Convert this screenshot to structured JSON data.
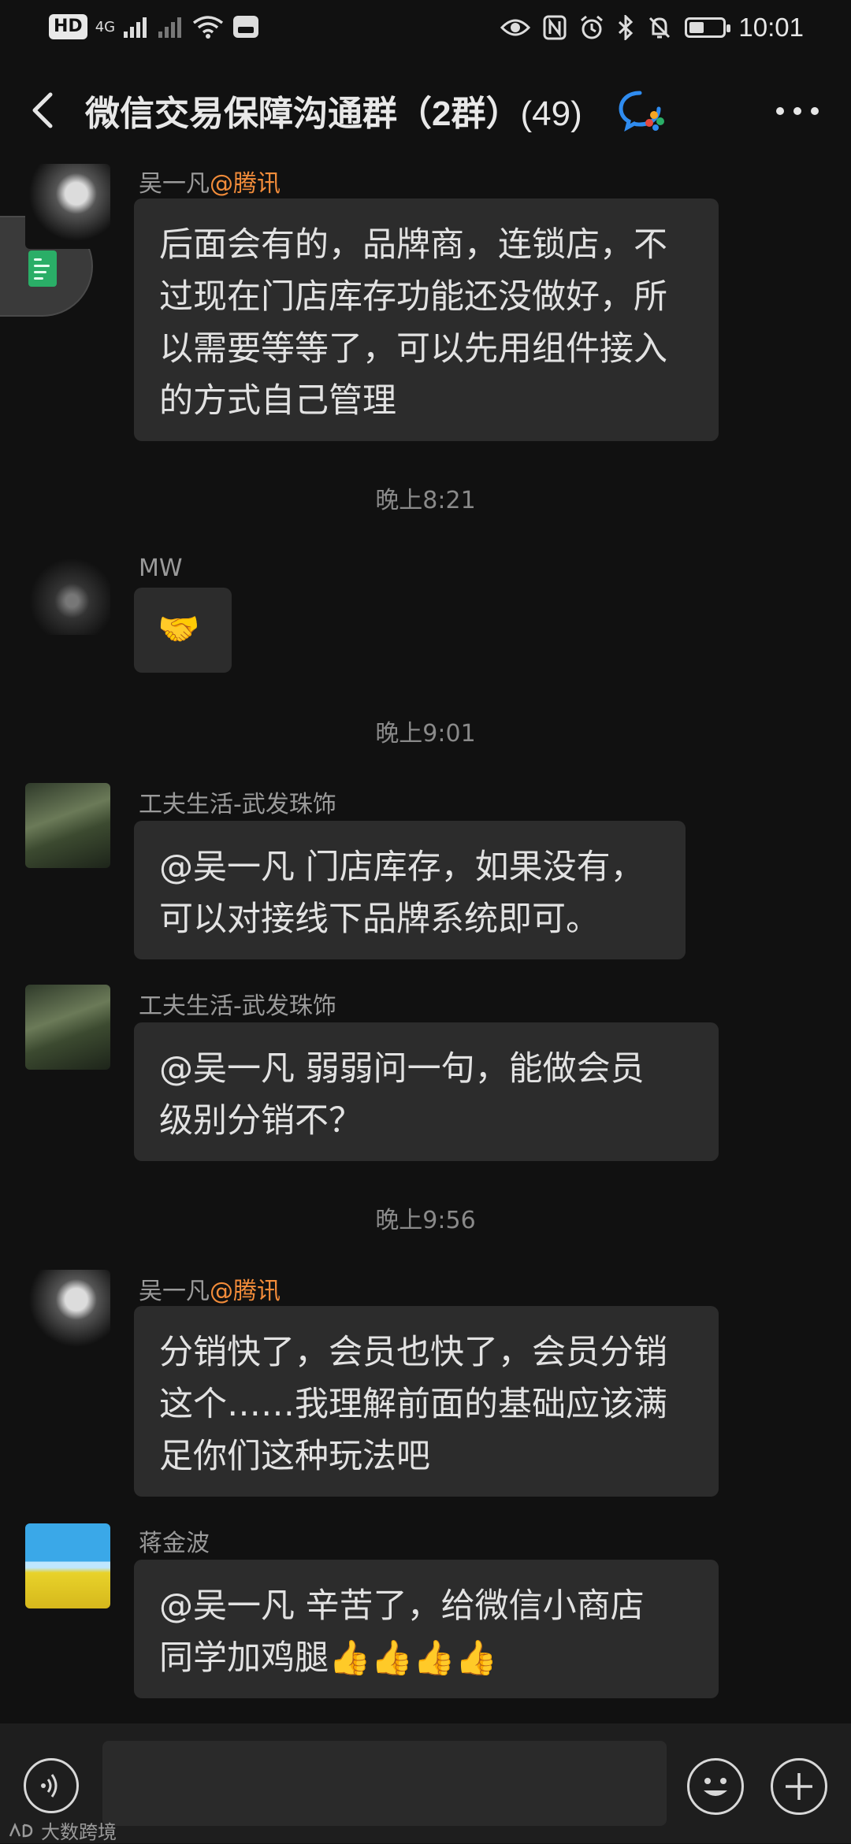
{
  "status_bar": {
    "hd": "HD",
    "network": "4G",
    "time": "10:01",
    "battery_level": 0.45,
    "icons": [
      "signal-icon",
      "wifi-icon",
      "eye-icon",
      "nfc-icon",
      "alarm-icon",
      "bluetooth-icon",
      "mute-icon",
      "battery-icon"
    ]
  },
  "header": {
    "title": "微信交易保障沟通群（2群）",
    "member_count": "(49)",
    "back_icon": "chevron-left-icon",
    "more_icon": "more-dots-icon"
  },
  "messages": [
    {
      "sender": "吴一凡",
      "org": "@腾讯",
      "lines": [
        "后面会有的，品牌商，连锁店，不",
        "过现在门店库存功能还没做好，所",
        "以需要等等了，可以先用组件接入",
        "的方式自己管理"
      ]
    },
    {
      "timestamp": "晚上8:21"
    },
    {
      "sender": "MW",
      "lines": [
        "🤝"
      ]
    },
    {
      "timestamp": "晚上9:01"
    },
    {
      "sender": "工夫生活-武发珠饰",
      "lines": [
        "@吴一凡  门店库存，如果没有，",
        "可以对接线下品牌系统即可。"
      ]
    },
    {
      "sender": "工夫生活-武发珠饰",
      "lines": [
        "@吴一凡  弱弱问一句，能做会员",
        "级别分销不？"
      ]
    },
    {
      "timestamp": "晚上9:56"
    },
    {
      "sender": "吴一凡",
      "org": "@腾讯",
      "lines": [
        "分销快了，会员也快了，会员分销",
        "这个……我理解前面的基础应该满",
        "足你们这种玩法吧"
      ]
    },
    {
      "sender": "蒋金波",
      "lines": [
        "@吴一凡  辛苦了，给微信小商店",
        "同学加鸡腿👍👍👍👍"
      ]
    }
  ],
  "input_bar": {
    "placeholder": "",
    "voice_icon": "voice-icon",
    "emoji_icon": "emoji-icon",
    "plus_icon": "plus-icon"
  },
  "watermark": "大数跨境",
  "colors": {
    "background": "#111111",
    "bubble": "#2c2c2c",
    "org_tag": "#f28c3a",
    "note_green": "#2aae67"
  }
}
